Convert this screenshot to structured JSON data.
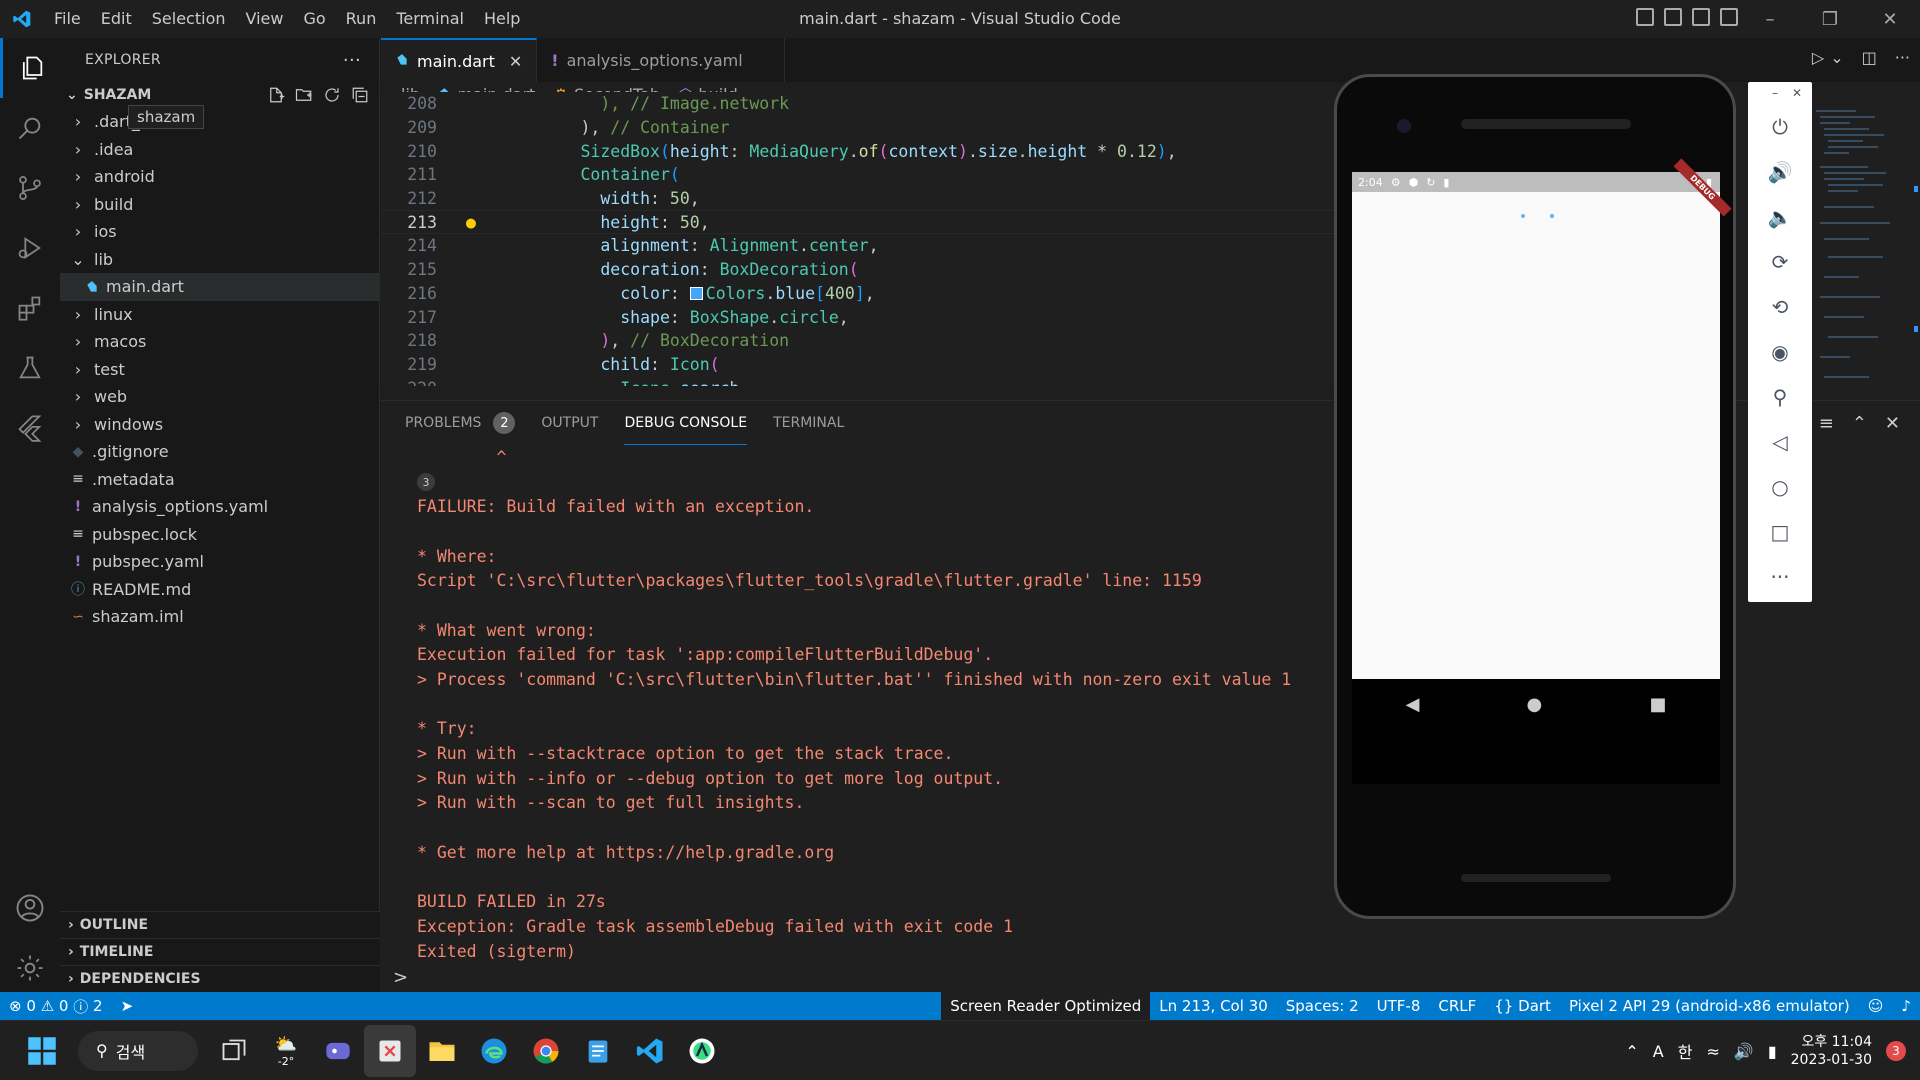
{
  "window": {
    "title": "main.dart - shazam - Visual Studio Code",
    "menu": [
      "File",
      "Edit",
      "Selection",
      "View",
      "Go",
      "Run",
      "Terminal",
      "Help"
    ]
  },
  "explorer": {
    "header": "EXPLORER",
    "root": "SHAZAM",
    "tooltip": "shazam",
    "items": [
      {
        "label": ".dart_tool",
        "type": "folder",
        "indent": 1,
        "expanded": false
      },
      {
        "label": ".idea",
        "type": "folder",
        "indent": 1,
        "expanded": false
      },
      {
        "label": "android",
        "type": "folder",
        "indent": 1,
        "expanded": false
      },
      {
        "label": "build",
        "type": "folder",
        "indent": 1,
        "expanded": false
      },
      {
        "label": "ios",
        "type": "folder",
        "indent": 1,
        "expanded": false
      },
      {
        "label": "lib",
        "type": "folder",
        "indent": 1,
        "expanded": true
      },
      {
        "label": "main.dart",
        "type": "dart",
        "indent": 2,
        "selected": true
      },
      {
        "label": "linux",
        "type": "folder",
        "indent": 1,
        "expanded": false
      },
      {
        "label": "macos",
        "type": "folder",
        "indent": 1,
        "expanded": false
      },
      {
        "label": "test",
        "type": "folder",
        "indent": 1,
        "expanded": false
      },
      {
        "label": "web",
        "type": "folder",
        "indent": 1,
        "expanded": false
      },
      {
        "label": "windows",
        "type": "folder",
        "indent": 1,
        "expanded": false
      },
      {
        "label": ".gitignore",
        "type": "git",
        "indent": 1
      },
      {
        "label": ".metadata",
        "type": "lines",
        "indent": 1
      },
      {
        "label": "analysis_options.yaml",
        "type": "yaml",
        "indent": 1
      },
      {
        "label": "pubspec.lock",
        "type": "lines",
        "indent": 1
      },
      {
        "label": "pubspec.yaml",
        "type": "yaml",
        "indent": 1
      },
      {
        "label": "README.md",
        "type": "info",
        "indent": 1
      },
      {
        "label": "shazam.iml",
        "type": "rss",
        "indent": 1
      }
    ],
    "sections": [
      "OUTLINE",
      "TIMELINE",
      "DEPENDENCIES"
    ]
  },
  "tabs": [
    {
      "label": "main.dart",
      "active": true,
      "icon": "dart-icon"
    },
    {
      "label": "analysis_options.yaml",
      "active": false,
      "icon": "yaml-icon"
    }
  ],
  "breadcrumb": [
    "lib",
    "main.dart",
    "SecondTab",
    "build"
  ],
  "editor": {
    "current_line": 213,
    "lines": [
      {
        "n": "208",
        "tokens": [
          {
            "t": "          ",
            "c": "t-punc"
          },
          {
            "t": "), // Image.network",
            "c": "t-cmt"
          }
        ]
      },
      {
        "n": "209",
        "tokens": [
          {
            "t": "        ",
            "c": "t-punc"
          },
          {
            "t": "), ",
            "c": "t-punc"
          },
          {
            "t": "// Container",
            "c": "t-cmt"
          }
        ]
      },
      {
        "n": "210",
        "tokens": [
          {
            "t": "        ",
            "c": "t-punc"
          },
          {
            "t": "SizedBox",
            "c": "t-cls"
          },
          {
            "t": "(",
            "c": "t-brk2"
          },
          {
            "t": "height",
            "c": "t-prop"
          },
          {
            "t": ": ",
            "c": "t-punc"
          },
          {
            "t": "MediaQuery",
            "c": "t-cls"
          },
          {
            "t": ".",
            "c": "t-punc"
          },
          {
            "t": "of",
            "c": "t-fn"
          },
          {
            "t": "(",
            "c": "t-brk"
          },
          {
            "t": "context",
            "c": "t-prop"
          },
          {
            "t": ")",
            "c": "t-brk"
          },
          {
            "t": ".",
            "c": "t-punc"
          },
          {
            "t": "size",
            "c": "t-prop"
          },
          {
            "t": ".",
            "c": "t-punc"
          },
          {
            "t": "height",
            "c": "t-prop"
          },
          {
            "t": " * ",
            "c": "t-punc"
          },
          {
            "t": "0.12",
            "c": "t-num"
          },
          {
            "t": ")",
            "c": "t-brk2"
          },
          {
            "t": ",",
            "c": "t-punc"
          }
        ]
      },
      {
        "n": "211",
        "tokens": [
          {
            "t": "        ",
            "c": "t-punc"
          },
          {
            "t": "Container",
            "c": "t-cls"
          },
          {
            "t": "(",
            "c": "t-brk2"
          }
        ]
      },
      {
        "n": "212",
        "tokens": [
          {
            "t": "          ",
            "c": "t-punc"
          },
          {
            "t": "width",
            "c": "t-prop"
          },
          {
            "t": ": ",
            "c": "t-punc"
          },
          {
            "t": "50",
            "c": "t-num"
          },
          {
            "t": ",",
            "c": "t-punc"
          }
        ]
      },
      {
        "n": "213",
        "tokens": [
          {
            "t": "          ",
            "c": "t-punc"
          },
          {
            "t": "height",
            "c": "t-prop"
          },
          {
            "t": ": ",
            "c": "t-punc"
          },
          {
            "t": "50",
            "c": "t-num"
          },
          {
            "t": ",",
            "c": "t-punc"
          }
        ]
      },
      {
        "n": "214",
        "tokens": [
          {
            "t": "          ",
            "c": "t-punc"
          },
          {
            "t": "alignment",
            "c": "t-prop"
          },
          {
            "t": ": ",
            "c": "t-punc"
          },
          {
            "t": "Alignment",
            "c": "t-cls"
          },
          {
            "t": ".",
            "c": "t-punc"
          },
          {
            "t": "center",
            "c": "t-cls"
          },
          {
            "t": ",",
            "c": "t-punc"
          }
        ]
      },
      {
        "n": "215",
        "tokens": [
          {
            "t": "          ",
            "c": "t-punc"
          },
          {
            "t": "decoration",
            "c": "t-prop"
          },
          {
            "t": ": ",
            "c": "t-punc"
          },
          {
            "t": "BoxDecoration",
            "c": "t-cls"
          },
          {
            "t": "(",
            "c": "t-brk"
          }
        ]
      },
      {
        "n": "216",
        "tokens": [
          {
            "t": "            ",
            "c": "t-punc"
          },
          {
            "t": "color",
            "c": "t-prop"
          },
          {
            "t": ": ",
            "c": "t-punc"
          },
          {
            "t": "SWATCH",
            "c": "swatch"
          },
          {
            "t": "Colors",
            "c": "t-cls"
          },
          {
            "t": ".",
            "c": "t-punc"
          },
          {
            "t": "blue",
            "c": "t-prop"
          },
          {
            "t": "[",
            "c": "t-brk2"
          },
          {
            "t": "400",
            "c": "t-num"
          },
          {
            "t": "]",
            "c": "t-brk2"
          },
          {
            "t": ",",
            "c": "t-punc"
          }
        ]
      },
      {
        "n": "217",
        "tokens": [
          {
            "t": "            ",
            "c": "t-punc"
          },
          {
            "t": "shape",
            "c": "t-prop"
          },
          {
            "t": ": ",
            "c": "t-punc"
          },
          {
            "t": "BoxShape",
            "c": "t-cls"
          },
          {
            "t": ".",
            "c": "t-punc"
          },
          {
            "t": "circle",
            "c": "t-cls"
          },
          {
            "t": ",",
            "c": "t-punc"
          }
        ]
      },
      {
        "n": "218",
        "tokens": [
          {
            "t": "          ",
            "c": "t-punc"
          },
          {
            "t": ")",
            "c": "t-brk"
          },
          {
            "t": ", ",
            "c": "t-punc"
          },
          {
            "t": "// BoxDecoration",
            "c": "t-cmt"
          }
        ]
      },
      {
        "n": "219",
        "tokens": [
          {
            "t": "          ",
            "c": "t-punc"
          },
          {
            "t": "child",
            "c": "t-prop"
          },
          {
            "t": ": ",
            "c": "t-punc"
          },
          {
            "t": "Icon",
            "c": "t-cls"
          },
          {
            "t": "(",
            "c": "t-brk"
          }
        ]
      },
      {
        "n": "220",
        "tokens": [
          {
            "t": "            ",
            "c": "t-punc"
          },
          {
            "t": "Icons",
            "c": "t-cls"
          },
          {
            "t": ".",
            "c": "t-punc"
          },
          {
            "t": "search",
            "c": "t-prop"
          },
          {
            "t": ",",
            "c": "t-punc"
          }
        ]
      }
    ],
    "swatch_color": "#42a5f5"
  },
  "panel": {
    "tabs": [
      {
        "label": "PROBLEMS",
        "badge": "2",
        "active": false
      },
      {
        "label": "OUTPUT",
        "active": false
      },
      {
        "label": "DEBUG CONSOLE",
        "active": true
      },
      {
        "label": "TERMINAL",
        "active": false
      }
    ],
    "console_lines": [
      {
        "text": "        ^",
        "color": "#f48771"
      },
      {
        "text": "3",
        "badge": true
      },
      {
        "text": "FAILURE: Build failed with an exception.",
        "color": "#f48771"
      },
      {
        "text": "",
        "color": "#f48771"
      },
      {
        "text": "* Where:",
        "color": "#f48771"
      },
      {
        "text": "Script 'C:\\src\\flutter\\packages\\flutter_tools\\gradle\\flutter.gradle' line: 1159",
        "color": "#f48771"
      },
      {
        "text": "",
        "color": "#f48771"
      },
      {
        "text": "* What went wrong:",
        "color": "#f48771"
      },
      {
        "text": "Execution failed for task ':app:compileFlutterBuildDebug'.",
        "color": "#f48771"
      },
      {
        "text": "> Process 'command 'C:\\src\\flutter\\bin\\flutter.bat'' finished with non-zero exit value 1",
        "color": "#f48771"
      },
      {
        "text": "",
        "color": "#f48771"
      },
      {
        "text": "* Try:",
        "color": "#f48771"
      },
      {
        "text": "> Run with --stacktrace option to get the stack trace.",
        "color": "#f48771"
      },
      {
        "text": "> Run with --info or --debug option to get more log output.",
        "color": "#f48771"
      },
      {
        "text": "> Run with --scan to get full insights.",
        "color": "#f48771"
      },
      {
        "text": "",
        "color": "#f48771"
      },
      {
        "text": "* Get more help at https://help.gradle.org",
        "color": "#f48771"
      },
      {
        "text": "",
        "color": "#f48771"
      },
      {
        "text": "BUILD FAILED in 27s",
        "color": "#f48771"
      },
      {
        "text": "Exception: Gradle task assembleDebug failed with exit code 1",
        "color": "#f48771"
      },
      {
        "text": "Exited (sigterm)",
        "color": "#f48771"
      }
    ],
    "prompt": ">"
  },
  "statusbar": {
    "errors": "0",
    "warnings": "0",
    "info": "2",
    "screen_reader": "Screen Reader Optimized",
    "position": "Ln 213, Col 30",
    "spaces": "Spaces: 2",
    "encoding": "UTF-8",
    "eol": "CRLF",
    "language": "Dart",
    "device": "Pixel 2 API 29 (android-x86 emulator)"
  },
  "emulator": {
    "time": "2:04",
    "ribbon": "DEBUG"
  },
  "taskbar": {
    "search_label": "검색",
    "weather": "-2°",
    "ime_a": "A",
    "ime_han": "한",
    "time": "오후 11:04",
    "date": "2023-01-30",
    "notifications": "3"
  }
}
